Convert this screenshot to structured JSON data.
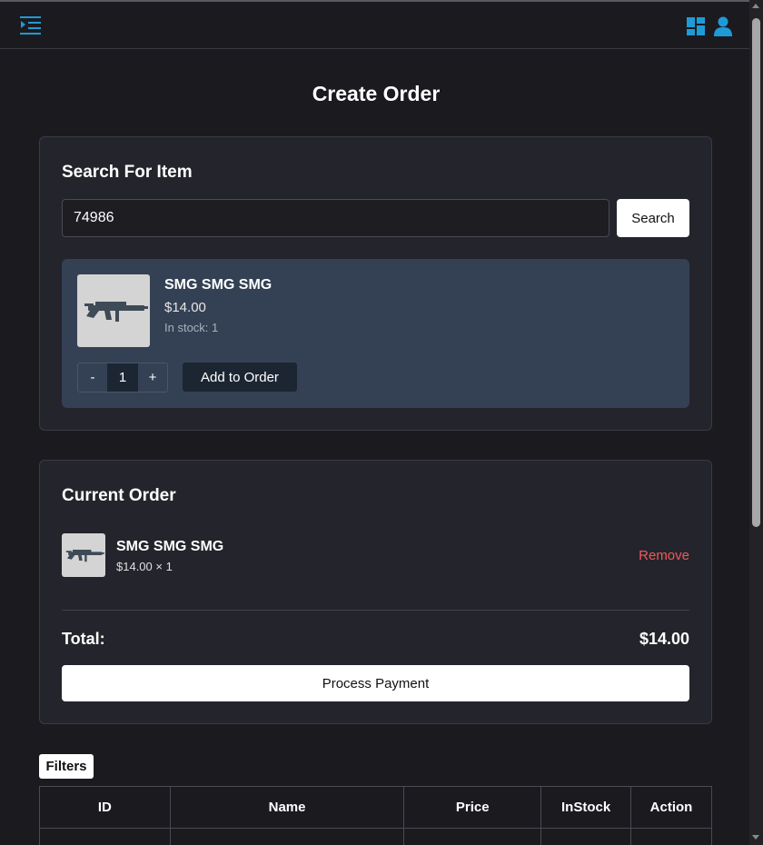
{
  "header": {
    "menu_icon": "menu-indent-icon",
    "dashboard_icon": "dashboard-icon",
    "user_icon": "user-icon",
    "accent_color": "#1e9bd7"
  },
  "page": {
    "title": "Create Order"
  },
  "search": {
    "title": "Search For Item",
    "input_value": "74986",
    "button_label": "Search"
  },
  "result": {
    "name": "SMG SMG SMG",
    "price": "$14.00",
    "stock": "In stock: 1",
    "qty_minus": "-",
    "qty_value": "1",
    "qty_plus": "+",
    "add_label": "Add to Order"
  },
  "order": {
    "title": "Current Order",
    "items": [
      {
        "name": "SMG SMG SMG",
        "detail": "$14.00 × 1",
        "remove_label": "Remove"
      }
    ],
    "total_label": "Total:",
    "total_value": "$14.00",
    "pay_label": "Process Payment",
    "remove_color": "#f05a5a"
  },
  "filters": {
    "label": "Filters"
  },
  "table": {
    "columns": [
      "ID",
      "Name",
      "Price",
      "InStock",
      "Action"
    ]
  }
}
